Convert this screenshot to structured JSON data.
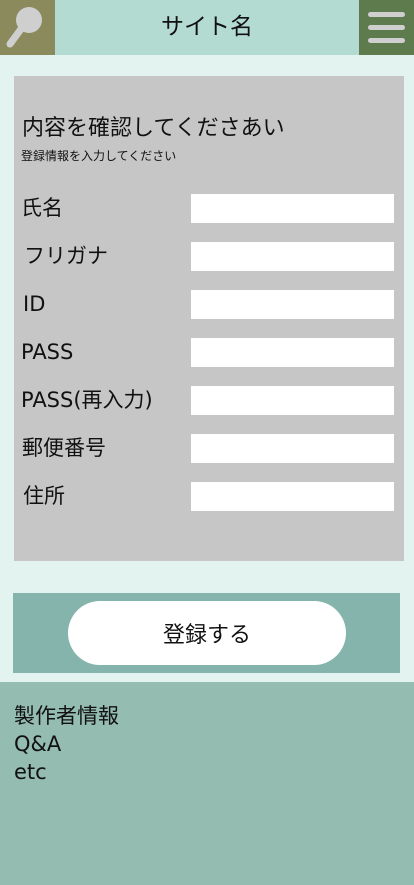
{
  "header": {
    "title": "サイト名",
    "search_icon": "search-icon",
    "menu_icon": "hamburger-menu-icon"
  },
  "form": {
    "heading": "内容を確認してくださあい",
    "subheading": "登録情報を入力してください",
    "fields": [
      {
        "label": "氏名",
        "value": ""
      },
      {
        "label": "フリガナ",
        "value": ""
      },
      {
        "label": "ID",
        "value": ""
      },
      {
        "label": "PASS",
        "value": ""
      },
      {
        "label": "PASS(再入力)",
        "value": ""
      },
      {
        "label": "郵便番号",
        "value": ""
      },
      {
        "label": "住所",
        "value": ""
      }
    ]
  },
  "submit": {
    "label": "登録する"
  },
  "footer": {
    "links": [
      "製作者情報",
      "Q&A",
      "etc"
    ]
  },
  "colors": {
    "header_bg": "#b4dbd2",
    "search_bg": "#8a8a5c",
    "menu_bg": "#5e7b4d",
    "page_bg": "#e3f3ef",
    "panel_bg": "#c6c6c6",
    "submit_section_bg": "#84b4ab",
    "footer_bg": "#94bcb1"
  }
}
